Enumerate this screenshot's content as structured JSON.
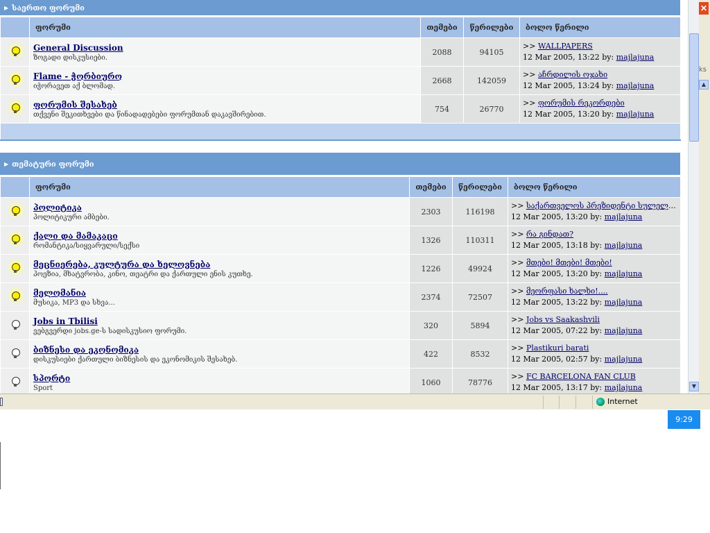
{
  "sections": [
    {
      "title": "საერთო ფორუმი",
      "columns": {
        "forum": "ფორუმი",
        "topics": "თემები",
        "posts": "წერილები",
        "last": "ბოლო წერილი"
      },
      "rows": [
        {
          "title": "General Discussion",
          "desc": "ზოგადი დისკუსიები.",
          "topics": "2088",
          "posts": "94105",
          "last_title": "WALLPAPERS",
          "last_date": "12 Mar 2005, 13:22 by:",
          "last_user": "majlajuna",
          "icon": "on"
        },
        {
          "title": "Flame - ჭორბიურო",
          "desc": "იჭორავეთ აქ ბლომად.",
          "topics": "2668",
          "posts": "142059",
          "last_title": "აჩრდილის ოჯახი",
          "last_date": "12 Mar 2005, 13:24 by:",
          "last_user": "majlajuna",
          "icon": "on"
        },
        {
          "title": "ფორუმის შესახებ",
          "desc": "თქვენი შეკითხვები და წინადადებები ფორუმთან დაკავშირებით.",
          "topics": "754",
          "posts": "26770",
          "last_title": "ფორუმის რეკორდები",
          "last_date": "12 Mar 2005, 13:20 by:",
          "last_user": "majlajuna",
          "icon": "on"
        }
      ]
    },
    {
      "title": "თემატური ფორუმი",
      "columns": {
        "forum": "ფორუმი",
        "topics": "თემები",
        "posts": "წერილები",
        "last": "ბოლო წერილი"
      },
      "rows": [
        {
          "title": "პოლიტიკა",
          "desc": "პოლიტიკური ამბები.",
          "topics": "2303",
          "posts": "116198",
          "last_title": "საქართველოს პრეზიდენტი სულელია...",
          "last_date": "12 Mar 2005, 13:20 by:",
          "last_user": "majlajuna",
          "icon": "on"
        },
        {
          "title": "ქალი და მამაკაცი",
          "desc": "რომანტიკა/სიყვარული/სექსი",
          "topics": "1326",
          "posts": "110311",
          "last_title": "რა გინდათ?",
          "last_date": "12 Mar 2005, 13:18 by:",
          "last_user": "majlajuna",
          "icon": "on"
        },
        {
          "title": "მეცნიერება, კულტურა და ხელოვნება",
          "desc": "პოეზია, მხატვრობა, კინო, თეატრი და ქართული ენის კუთხე.",
          "topics": "1226",
          "posts": "49924",
          "last_title": "მთები! მთები! მთები!",
          "last_date": "12 Mar 2005, 13:20 by:",
          "last_user": "majlajuna",
          "icon": "on"
        },
        {
          "title": "მელომანია",
          "desc": "მუსიკა, MP3 და სხვა...",
          "topics": "2374",
          "posts": "72507",
          "last_title": "მეორფასი ხალხი!....",
          "last_date": "12 Mar 2005, 13:22 by:",
          "last_user": "majlajuna",
          "icon": "on"
        },
        {
          "title": "Jobs in Tbilisi",
          "desc": "ვებგვერდი jobs.ge-ს სადისკუსიო ფორუმი.",
          "topics": "320",
          "posts": "5894",
          "last_title": "Jobs vs Saakashvili",
          "last_date": "12 Mar 2005, 07:22 by:",
          "last_user": "majlajuna",
          "icon": "off"
        },
        {
          "title": "ბიზნესი და ეკონომიკა",
          "desc": "დისკუსიები ქართული ბიზნესის და ეკონომიკის შესახებ.",
          "topics": "422",
          "posts": "8532",
          "last_title": "Plastikuri barati",
          "last_date": "12 Mar 2005, 02:57 by:",
          "last_user": "majlajuna",
          "icon": "off"
        },
        {
          "title": "სპორტი",
          "desc": "Sport",
          "topics": "1060",
          "posts": "78776",
          "last_title": "FC BARCELONA FAN CLUB",
          "last_date": "12 Mar 2005, 13:17 by:",
          "last_user": "majlajuna",
          "icon": "off"
        }
      ]
    }
  ],
  "last_prefix": ">>",
  "statusbar": {
    "zone": "Internet"
  },
  "taskbar": {
    "clock": "9:29"
  },
  "toolbar_fragment": "ks"
}
